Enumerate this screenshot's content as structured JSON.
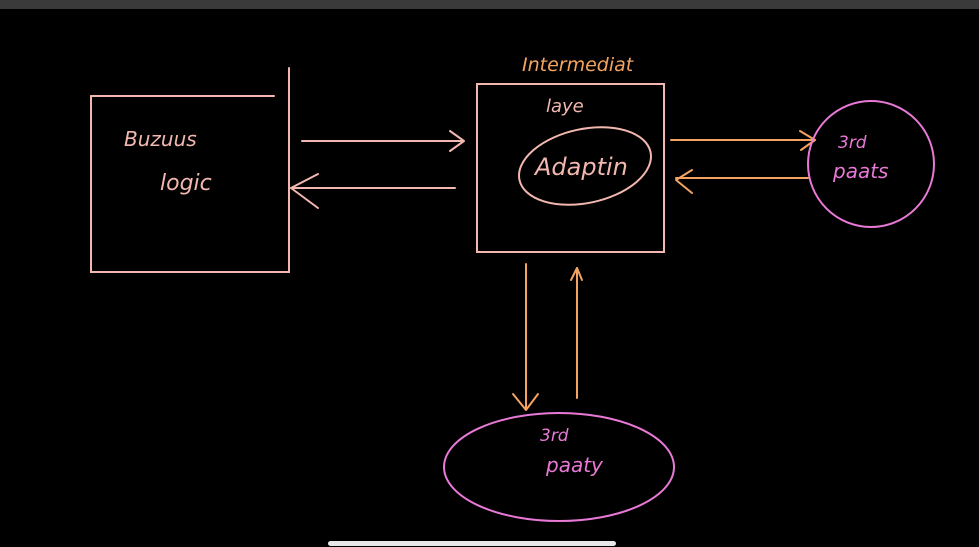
{
  "colors": {
    "background": "#000000",
    "box_stroke": "#f2b8b0",
    "orange": "#f4a460",
    "pink": "#e879d6",
    "topbar": "#3a3a3a",
    "home_indicator": "#e8e8e8"
  },
  "diagram": {
    "business_logic": {
      "line1": "Buzuus",
      "line2": "logic"
    },
    "intermediate": {
      "title": "Intermediat",
      "subtitle": "laye",
      "adapter_label": "Adaptin"
    },
    "third_party_right": {
      "line1": "3rd",
      "line2": "paats"
    },
    "third_party_bottom": {
      "line1": "3rd",
      "line2": "paaty"
    }
  }
}
